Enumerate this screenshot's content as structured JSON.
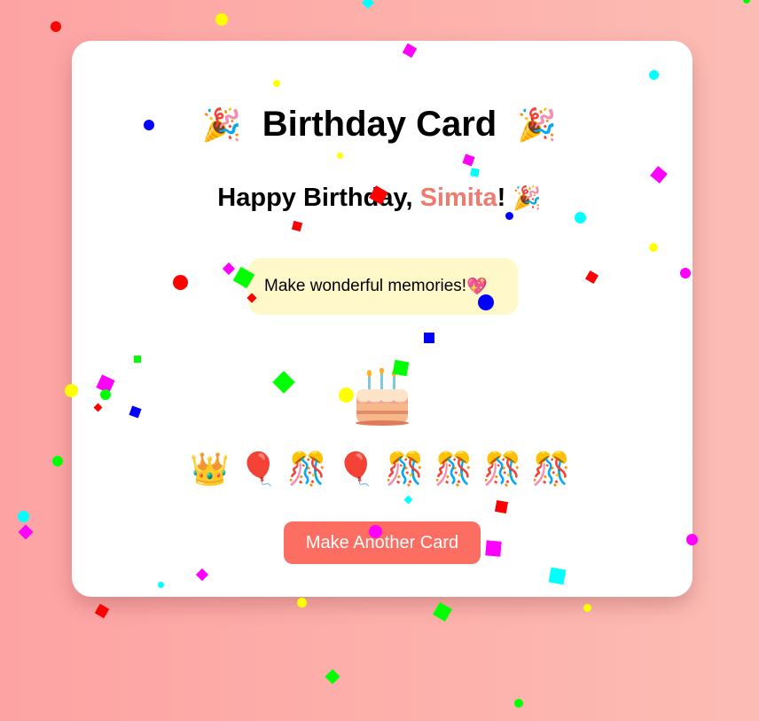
{
  "card": {
    "title": "Birthday Card",
    "title_emoji_left": "🎉",
    "title_emoji_right": "🎉",
    "greeting_prefix": "Happy Birthday, ",
    "recipient_name": "Simita",
    "greeting_suffix": "!",
    "greeting_emoji": "🎉",
    "message": "Make wonderful memories!",
    "message_emoji": "💖",
    "cake_icon": "birthday-cake-icon",
    "decorations": [
      "👑",
      "🎈",
      "🎊",
      "🎈",
      "🎊",
      "🎊",
      "🎊",
      "🎊"
    ],
    "button_label": "Make Another Card"
  },
  "colors": {
    "background": "#fda3a3",
    "card": "#ffffff",
    "name_accent": "#f07a6e",
    "message_bg": "#fff9c9",
    "button": "#fc6e61",
    "confetti": [
      "#ff0000",
      "#ffff00",
      "#00ff00",
      "#0000ff",
      "#ff00ff",
      "#00ffff"
    ]
  }
}
